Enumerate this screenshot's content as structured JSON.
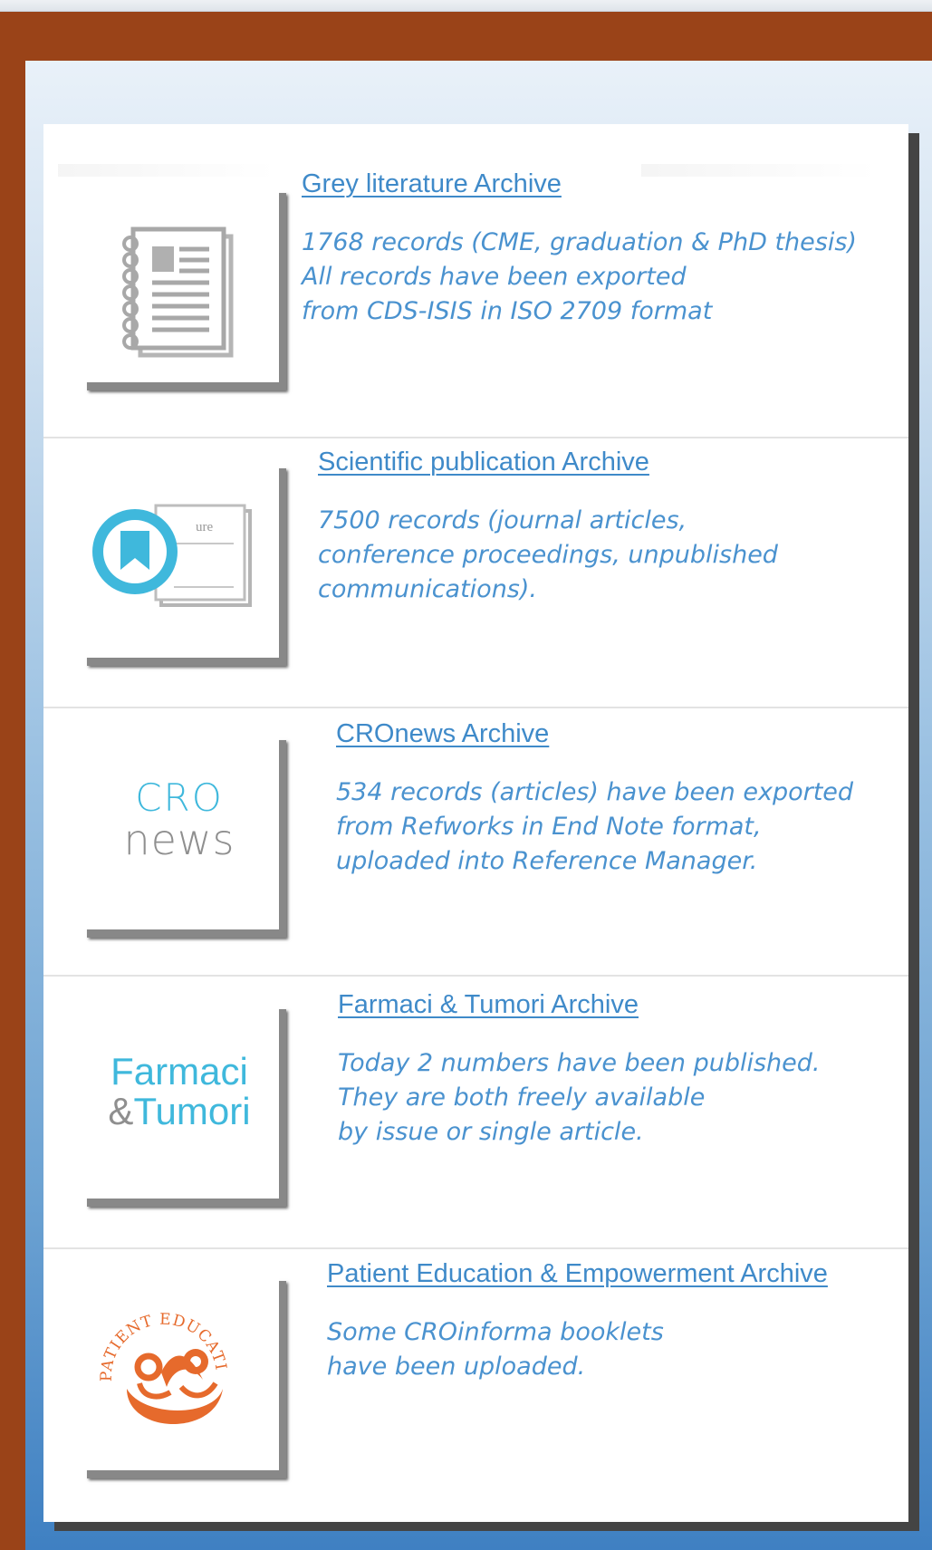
{
  "archives": [
    {
      "title": "Grey literature Archive",
      "description": "1768 records (CME, graduation & PhD thesis)\nAll records have been exported\nfrom CDS-ISIS in ISO 2709 format",
      "icon": "notebook-icon"
    },
    {
      "title": "Scientific publication Archive",
      "description": "7500 records (journal articles,\nconference proceedings, unpublished\ncommunications).",
      "icon": "bookmark-icon",
      "thumb_text": "ure"
    },
    {
      "title": "CROnews Archive",
      "description": "534 records (articles) have been exported\nfrom Refworks in End Note format,\nuploaded into Reference Manager.",
      "icon": "cronews-logo",
      "logo_line1": "CRO",
      "logo_line2": "news"
    },
    {
      "title": "Farmaci & Tumori Archive",
      "description": "Today 2 numbers have been published.\nThey are both freely available\nby issue or single article.",
      "icon": "farmaci-tumori-logo",
      "logo_line1": "Farmaci",
      "logo_amp": "&",
      "logo_line2": "Tumori"
    },
    {
      "title": "Patient Education & Empowerment Archive",
      "description": "Some CROinforma booklets\nhave been uploaded.",
      "icon": "patient-education-logo",
      "logo_text": "PATIENT EDUCATION"
    }
  ],
  "colors": {
    "frame": "#9a4318",
    "link": "#3f8ac9",
    "text": "#4a92cf",
    "bookmark": "#3fb8dc",
    "orange": "#e66a2c"
  }
}
